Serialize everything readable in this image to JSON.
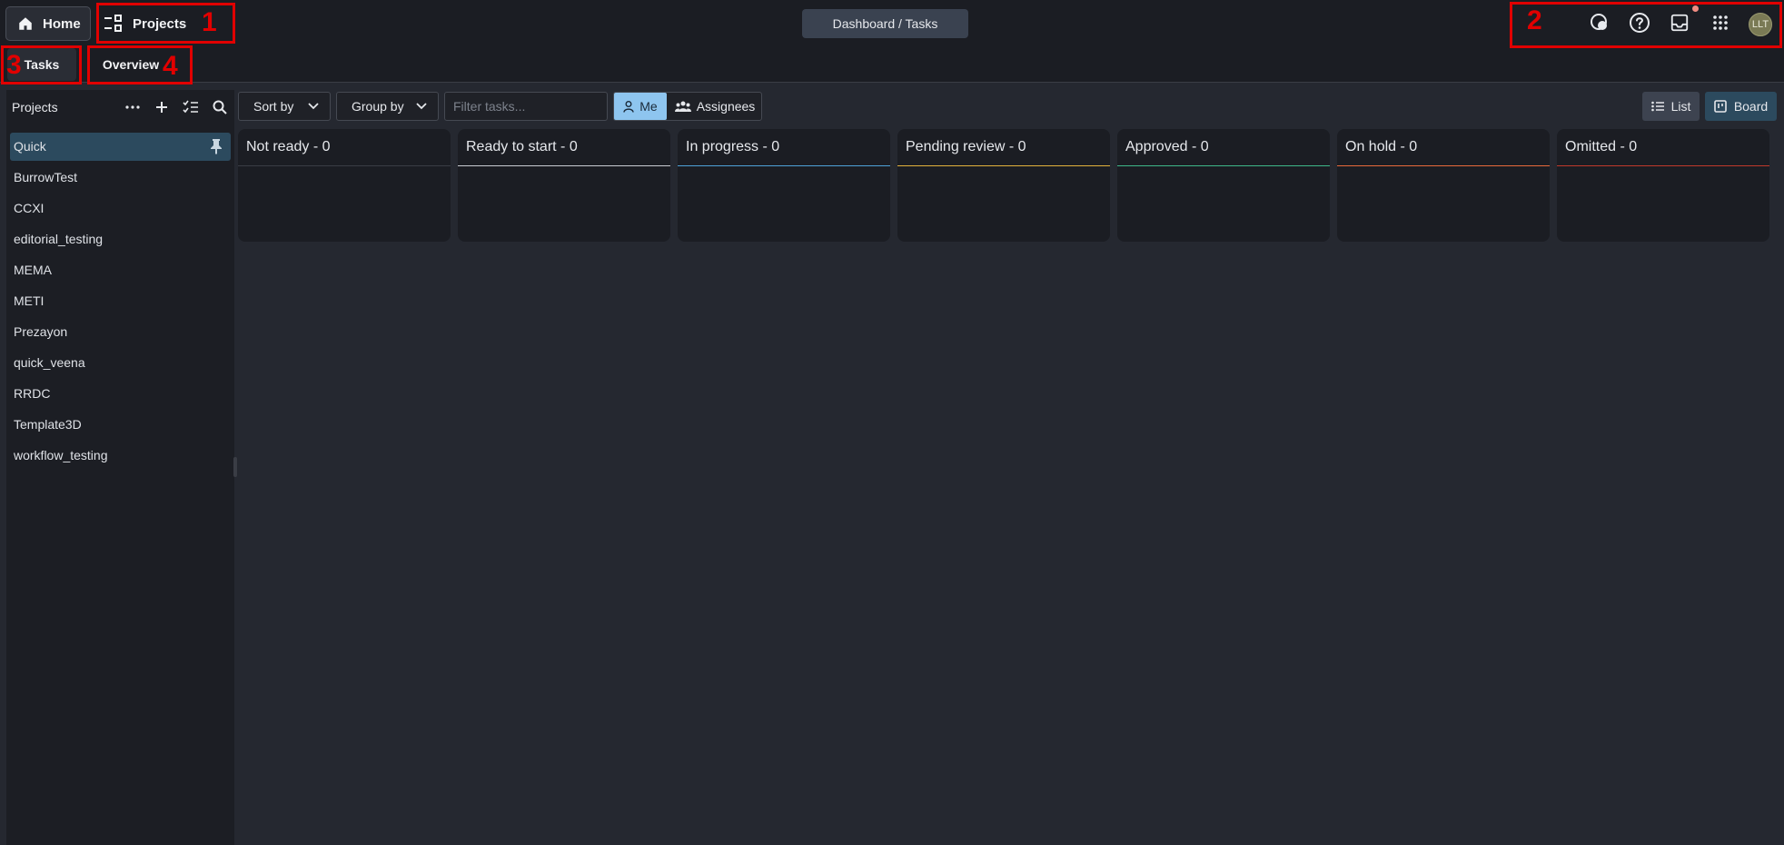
{
  "nav": {
    "home_label": "Home",
    "projects_label": "Projects"
  },
  "breadcrumb": "Dashboard / Tasks",
  "user": {
    "initials": "LLT"
  },
  "tabs": [
    {
      "label": "Tasks"
    },
    {
      "label": "Overview"
    }
  ],
  "sidebar": {
    "title": "Projects",
    "projects": [
      {
        "name": "Quick",
        "pinned": true,
        "active": true
      },
      {
        "name": "BurrowTest"
      },
      {
        "name": "CCXI"
      },
      {
        "name": "editorial_testing"
      },
      {
        "name": "MEMA"
      },
      {
        "name": "METI"
      },
      {
        "name": "Prezayon"
      },
      {
        "name": "quick_veena"
      },
      {
        "name": "RRDC"
      },
      {
        "name": "Template3D"
      },
      {
        "name": "workflow_testing"
      }
    ]
  },
  "toolbar": {
    "sort_label": "Sort by",
    "group_label": "Group by",
    "filter_placeholder": "Filter tasks...",
    "me_label": "Me",
    "assignees_label": "Assignees",
    "list_label": "List",
    "board_label": "Board"
  },
  "board": {
    "columns": [
      {
        "title": "Not ready - 0",
        "color": "#3a3d45"
      },
      {
        "title": "Ready to start - 0",
        "color": "#c8ccd2"
      },
      {
        "title": "In progress - 0",
        "color": "#4fa3d9"
      },
      {
        "title": "Pending review - 0",
        "color": "#e3b23c"
      },
      {
        "title": "Approved - 0",
        "color": "#3fb88a"
      },
      {
        "title": "On hold - 0",
        "color": "#e86a3a"
      },
      {
        "title": "Omitted - 0",
        "color": "#c0392b"
      }
    ]
  },
  "annotations": {
    "labels": [
      "1",
      "2",
      "3",
      "4"
    ],
    "color": "#e10000"
  }
}
